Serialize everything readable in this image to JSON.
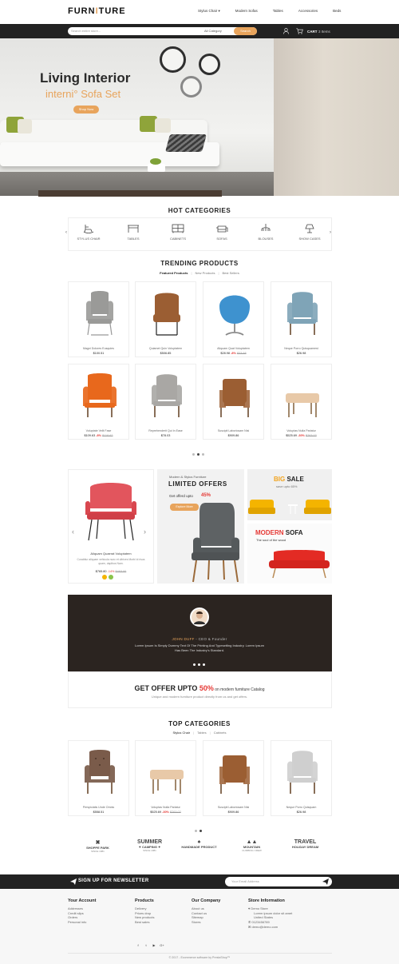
{
  "header": {
    "logo_left": "FURN",
    "logo_bar": "I",
    "logo_right": "TURE",
    "nav": [
      "Stylus Chair ▾",
      "Modern Sofas",
      "Tables",
      "Accessories",
      "Beds"
    ]
  },
  "search": {
    "placeholder": "Search entire store...",
    "category": "All Category",
    "button": "Search",
    "cart_label": "CART",
    "cart_count": "3 Items"
  },
  "hero": {
    "title": "Living Interior",
    "subtitle": "interni° Sofa Set",
    "button": "Shop Now"
  },
  "hot_categories": {
    "title": "HOT CATEGORIES",
    "items": [
      {
        "label": "STYLUS CHAIR",
        "icon": "rocking-chair-icon"
      },
      {
        "label": "TABLES",
        "icon": "table-icon"
      },
      {
        "label": "CABINETS",
        "icon": "cabinet-icon"
      },
      {
        "label": "SOFAS",
        "icon": "sofa-icon"
      },
      {
        "label": "BLOUSES",
        "icon": "chandelier-icon"
      },
      {
        "label": "SHOW CASES",
        "icon": "lamp-icon"
      }
    ]
  },
  "trending": {
    "title": "TRENDING PRODUCTS",
    "tabs": [
      "Featured Products",
      "New Products",
      "Best Sellers"
    ],
    "products": [
      {
        "name": "Magni Dolores Eusquies",
        "price": "$100.51",
        "old": "",
        "off": "",
        "color": "#9a9a98",
        "kind": "wing"
      },
      {
        "name": "Quiamet Quin Voluptatem",
        "price": "$506.85",
        "old": "",
        "off": "",
        "color": "#9b5e33",
        "kind": "lounge"
      },
      {
        "name": "Aliquam Quat Voluptatem",
        "price": "$28.98",
        "old": "$33.68",
        "off": "-8%",
        "color": "#3e92cf",
        "kind": "egg"
      },
      {
        "name": "Neque Porro Quisquamest",
        "price": "$26.98",
        "old": "",
        "off": "",
        "color": "#7fa4b7",
        "kind": "armchair"
      },
      {
        "name": "Voluptate Velit Fase",
        "price": "$109.63",
        "old": "$119.62",
        "off": "-8%",
        "color": "#e8681c",
        "kind": "chesterfield"
      },
      {
        "name": "Reprehenderit Qui In Ease",
        "price": "$78.03",
        "old": "",
        "off": "",
        "color": "#a9a7a4",
        "kind": "armchair"
      },
      {
        "name": "Suscipit Laboriosam Nisi",
        "price": "$909.86",
        "old": "",
        "off": "",
        "color": "#9b5e33",
        "kind": "club"
      },
      {
        "name": "Voluptas Nulla Pariatur",
        "price": "$525.69",
        "old": "$763.02",
        "off": "-30%",
        "color": "#e8c9a8",
        "kind": "ottoman"
      }
    ]
  },
  "offers": {
    "featured_title": "Aliquam Quaerat Voluptatem",
    "featured_desc": "Curabitur aliquam vehicula nunc et ultrices Morbi id risus quam, dapibus Nam.",
    "featured_price": "$765.80",
    "featured_off": "-14%",
    "featured_old": "$463.00",
    "small": "Modern & Stylus Furniture",
    "big": "LIMITED OFFERS",
    "upto": "Get offerd upto",
    "pct": "45%",
    "button": "Explore More",
    "sale_big": "BIG",
    "sale_rest": " SALE",
    "sale_sub": "save upto 65%",
    "modern": "MODERN",
    "sofa": " SOFA",
    "modern_sub": "The soul of the wood"
  },
  "testimonial": {
    "name": "JOHN DUFF",
    "role": " - CEO & Founder",
    "text": "Lorem Ipsum Is Simply Dummy Text Of The Printing And Typesetting Industry. Lorem Ipsum Has Been The Industry's Standard."
  },
  "get_offer": {
    "pre": "GET OFFER UPTO ",
    "pct": "50%",
    "post": " on modern furniture Catalog",
    "sub": "Unique and modern furniture product directly from us and get offers."
  },
  "top_categories": {
    "title": "TOP CATEGORIES",
    "tabs": [
      "Stylus Chair",
      "Tables",
      "Cabinets"
    ],
    "products": [
      {
        "name": "Perspiciatis Unde Omnis",
        "price": "$558.51",
        "old": "",
        "off": "",
        "color": "#7a5b4a",
        "kind": "tufted"
      },
      {
        "name": "Voluptas Nulla Pariatur",
        "price": "$525.69",
        "old": "$763.02",
        "off": "-30%",
        "color": "#e8c9a8",
        "kind": "ottoman"
      },
      {
        "name": "Suscipit Laboriosam Nisi",
        "price": "$909.86",
        "old": "",
        "off": "",
        "color": "#9b5e33",
        "kind": "club"
      },
      {
        "name": "Neque Porro Quisquam",
        "price": "$26.98",
        "old": "",
        "off": "",
        "color": "#cfcfcf",
        "kind": "armchair"
      }
    ]
  },
  "brands": [
    {
      "line1": "✖",
      "line2": "SHOPPE PARK",
      "line3": "SINCE 1981"
    },
    {
      "line1": "SUMMER",
      "line2": "✦ CAMPING ✦",
      "line3": "SINCE 1981"
    },
    {
      "line1": "♠",
      "line2": "HANDMADE PRODUCT",
      "line3": ""
    },
    {
      "line1": "▲▲",
      "line2": "MOUNTAIN",
      "line3": "CLIMBING CREW"
    },
    {
      "line1": "TRAVEL",
      "line2": "HOLIDAY DREAM",
      "line3": ""
    }
  ],
  "newsletter": {
    "label": "SIGN UP FOR NEWSLETTER",
    "placeholder": "Your Email Address"
  },
  "footer": {
    "account": {
      "title": "Your Account",
      "links": [
        "Addresses",
        "Credit slips",
        "Orders",
        "Personal info"
      ]
    },
    "products": {
      "title": "Products",
      "links": [
        "Delivery",
        "Prices drop",
        "New products",
        "Best sales"
      ]
    },
    "company": {
      "title": "Our Company",
      "links": [
        "About us",
        "Contact us",
        "Sitemap",
        "Stores"
      ]
    },
    "store": {
      "title": "Store Information",
      "lines": [
        "Demo Store",
        "Lorem ipsum dolor sit amet",
        "United States",
        "0123456789",
        "demo@demo.com"
      ]
    },
    "social": [
      "f",
      "t",
      "▶",
      "G+"
    ],
    "copyright": "© 2017 - Ecommerce software by PrestaShop™"
  },
  "accent_color": "#e8a45c"
}
